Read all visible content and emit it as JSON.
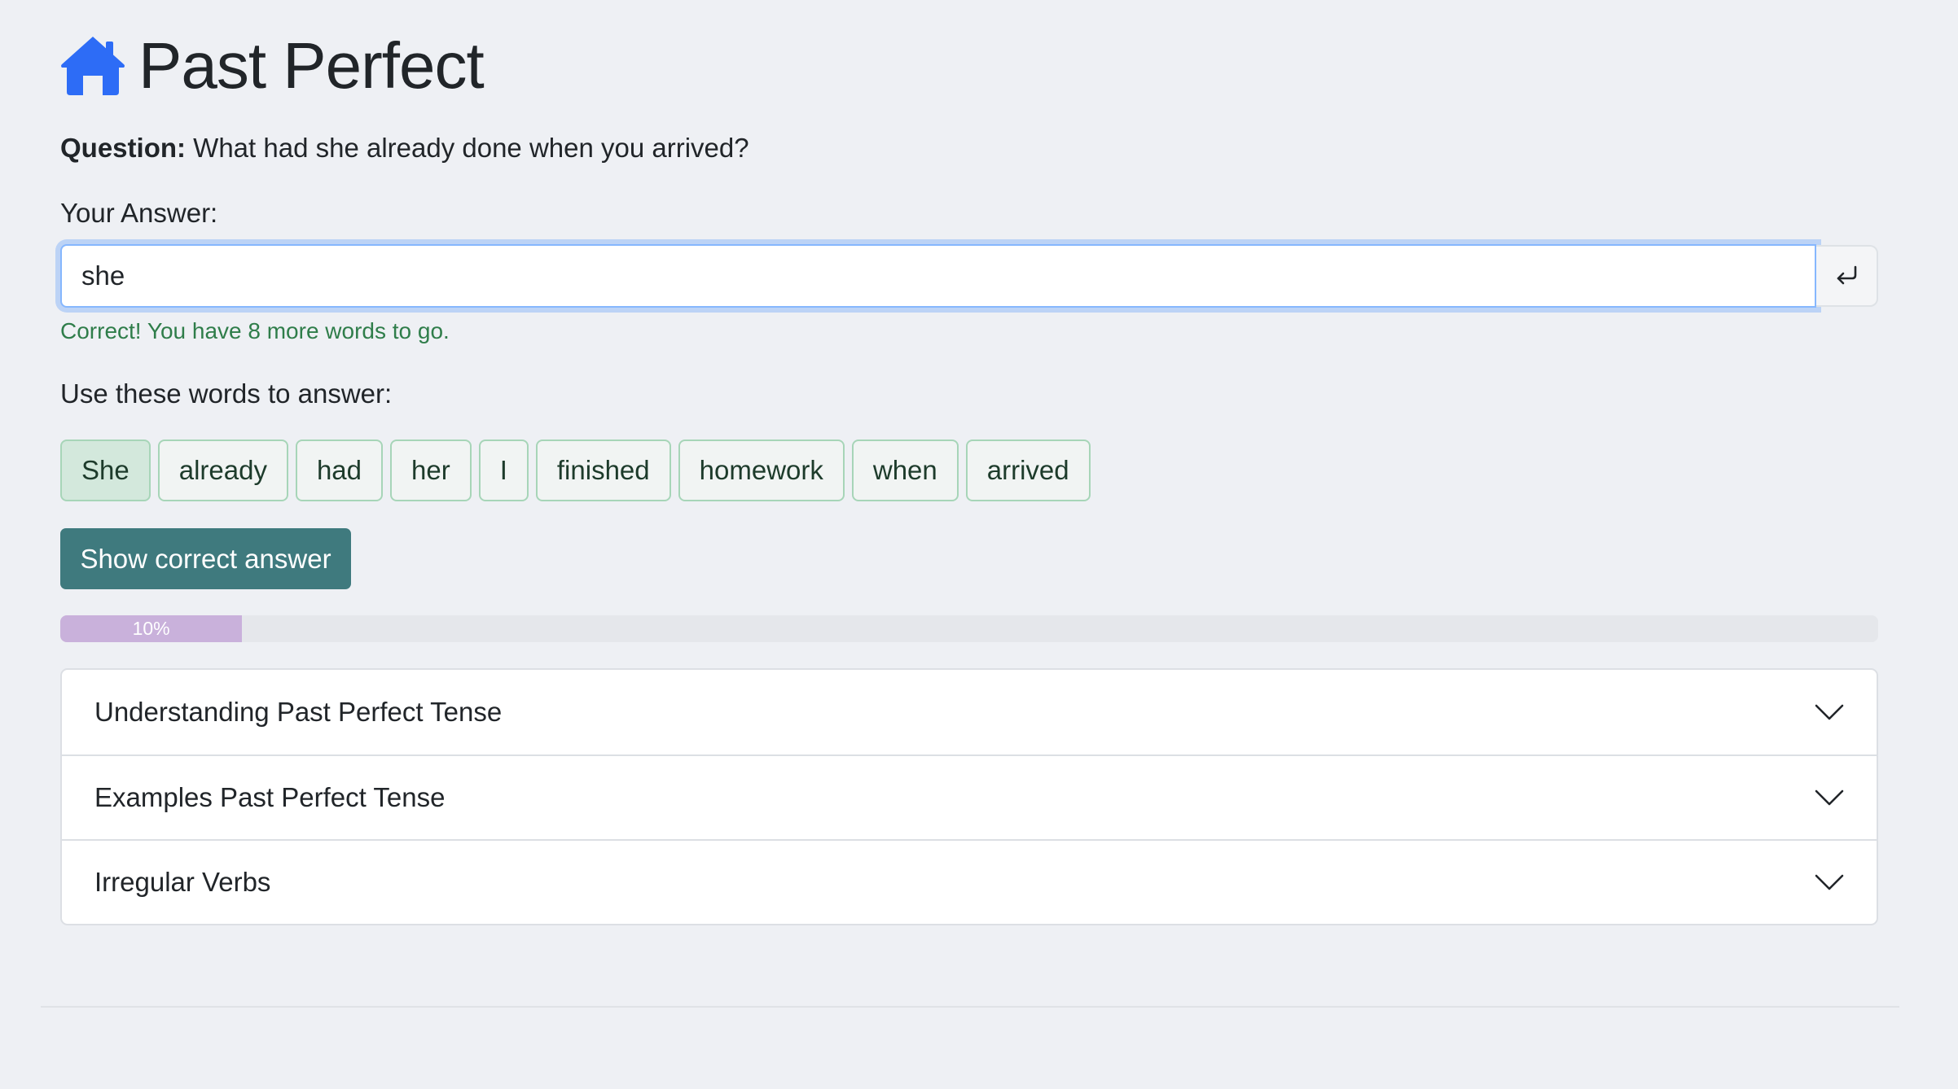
{
  "header": {
    "title": "Past Perfect",
    "home_icon": "home-icon"
  },
  "question": {
    "label": "Question:",
    "text": "What had she already done when you arrived?"
  },
  "answer": {
    "label": "Your Answer:",
    "value": "she",
    "submit_icon": "enter-icon"
  },
  "feedback": {
    "text": "Correct! You have 8 more words to go.",
    "color": "#2f7d4a"
  },
  "words": {
    "label": "Use these words to answer:",
    "items": [
      {
        "text": "She",
        "used": true
      },
      {
        "text": "already",
        "used": false
      },
      {
        "text": "had",
        "used": false
      },
      {
        "text": "her",
        "used": false
      },
      {
        "text": "I",
        "used": false
      },
      {
        "text": "finished",
        "used": false
      },
      {
        "text": "homework",
        "used": false
      },
      {
        "text": "when",
        "used": false
      },
      {
        "text": "arrived",
        "used": false
      }
    ]
  },
  "show_answer": {
    "label": "Show correct answer"
  },
  "progress": {
    "value": 10,
    "label": "10%"
  },
  "accordion": {
    "items": [
      {
        "label": "Understanding Past Perfect Tense"
      },
      {
        "label": "Examples Past Perfect Tense"
      },
      {
        "label": "Irregular Verbs"
      }
    ]
  },
  "colors": {
    "accent": "#0d6efd",
    "primary_button": "#3f7a7e",
    "progress_fill": "#c9b1db",
    "chip_border": "#a7d5b8"
  }
}
